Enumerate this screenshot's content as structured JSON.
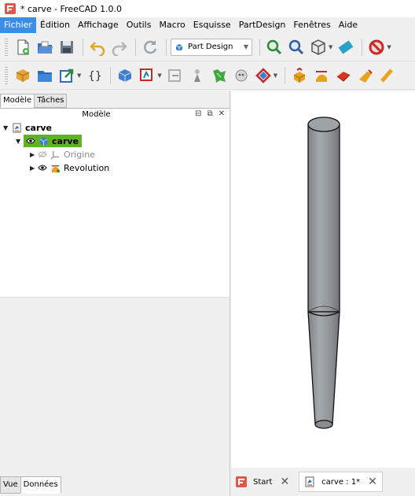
{
  "window": {
    "title": "* carve - FreeCAD 1.0.0"
  },
  "menu": [
    {
      "label": "Fichier",
      "active": true
    },
    {
      "label": "Édition",
      "active": false
    },
    {
      "label": "Affichage",
      "active": false
    },
    {
      "label": "Outils",
      "active": false
    },
    {
      "label": "Macro",
      "active": false
    },
    {
      "label": "Esquisse",
      "active": false
    },
    {
      "label": "PartDesign",
      "active": false
    },
    {
      "label": "Fenêtres",
      "active": false
    },
    {
      "label": "Aide",
      "active": false
    }
  ],
  "toolbar": {
    "workbench": "Part Design"
  },
  "panel": {
    "tabs": [
      "Modèle",
      "Tâches"
    ],
    "header": "Modèle",
    "tree": {
      "document": "carve",
      "body": "carve",
      "origin": "Origine",
      "feature": "Revolution"
    },
    "bottom_tabs": [
      "Vue",
      "Données"
    ]
  },
  "doc_tabs": [
    {
      "label": "Start",
      "active": false
    },
    {
      "label": "carve : 1*",
      "active": true
    }
  ],
  "colors": {
    "selection": "#5fb323",
    "menu_active": "#3a8ee6",
    "part": "#8f9499"
  }
}
